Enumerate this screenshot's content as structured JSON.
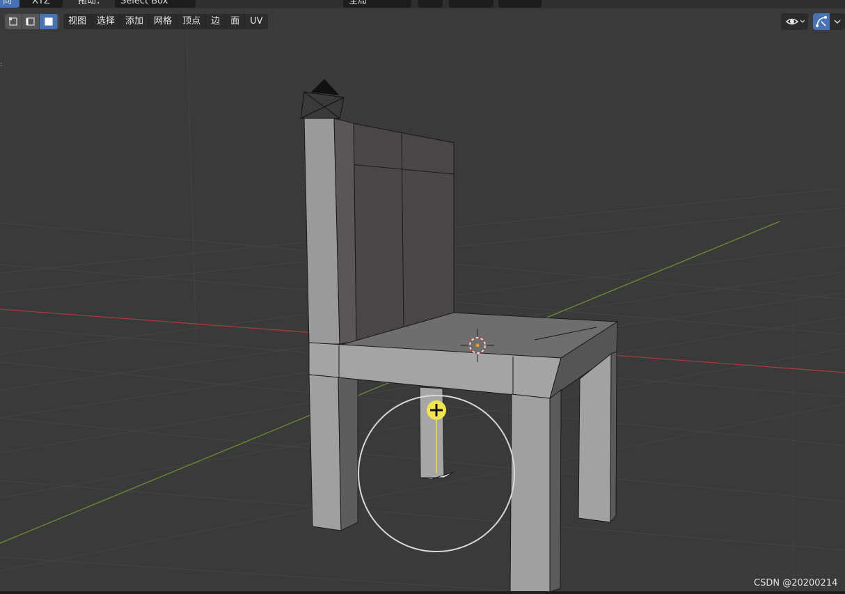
{
  "topbar": {
    "mode_tab": "向",
    "axis_label": "XYZ",
    "drag_label": "拖动：",
    "drag_value": "Select Box",
    "orientation_value": "全局"
  },
  "toolbar": {
    "select_modes": [
      "vertex-select",
      "edge-select",
      "face-select"
    ],
    "menus": [
      "视图",
      "选择",
      "添加",
      "网格",
      "顶点",
      "边",
      "面",
      "UV"
    ]
  },
  "icons": {
    "chevron": "▾",
    "visibility": "eye-icon",
    "gizmo": "gizmo-icon"
  },
  "colors": {
    "accent": "#4772b3",
    "viewport_bg": "#3a3a3a",
    "x_axis": "#a83a3a",
    "y_axis": "#6e8c30",
    "cursor_yellow": "#f2e44a"
  },
  "watermark": "CSDN @20200214"
}
